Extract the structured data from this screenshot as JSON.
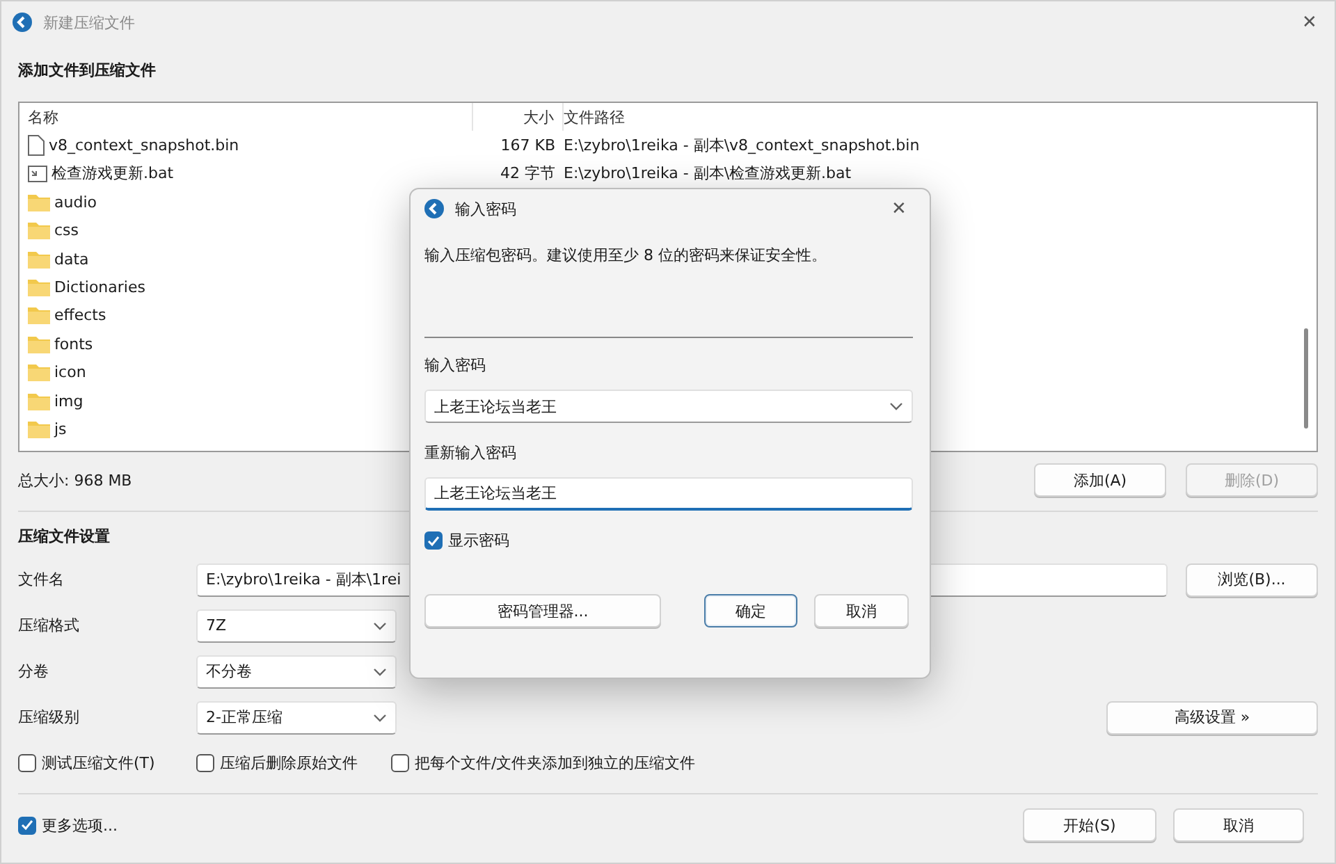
{
  "window": {
    "title": "新建压缩文件",
    "close": "✕"
  },
  "add_section": {
    "title": "添加文件到压缩文件"
  },
  "file_list": {
    "columns": [
      "名称",
      "大小",
      "文件路径"
    ],
    "rows": [
      {
        "kind": "file",
        "name": "v8_context_snapshot.bin",
        "size": "167 KB",
        "path": "E:\\zybro\\1reika - 副本\\v8_context_snapshot.bin"
      },
      {
        "kind": "script",
        "name": "检查游戏更新.bat",
        "size": "42 字节",
        "path": "E:\\zybro\\1reika - 副本\\检查游戏更新.bat"
      },
      {
        "kind": "folder",
        "name": "audio"
      },
      {
        "kind": "folder",
        "name": "css"
      },
      {
        "kind": "folder",
        "name": "data"
      },
      {
        "kind": "folder",
        "name": "Dictionaries"
      },
      {
        "kind": "folder",
        "name": "effects"
      },
      {
        "kind": "folder",
        "name": "fonts"
      },
      {
        "kind": "folder",
        "name": "icon"
      },
      {
        "kind": "folder",
        "name": "img"
      },
      {
        "kind": "folder",
        "name": "js"
      }
    ]
  },
  "total": "总大小: 968 MB",
  "list_buttons": [
    {
      "label": "添加(A)",
      "disabled": false
    },
    {
      "label": "删除(D)",
      "disabled": true
    }
  ],
  "settings": {
    "title": "压缩文件设置",
    "filename": {
      "label": "文件名",
      "value": "E:\\zybro\\1reika - 副本\\1rei",
      "browse": "浏览(B)..."
    },
    "selects": [
      {
        "label": "压缩格式",
        "value": "7Z"
      },
      {
        "label": "分卷",
        "value": "不分卷"
      },
      {
        "label": "压缩级别",
        "value": "2-正常压缩"
      }
    ],
    "advanced": "高级设置 »",
    "options": [
      {
        "label": "测试压缩文件(T)",
        "checked": false
      },
      {
        "label": "压缩后删除原始文件",
        "checked": false
      },
      {
        "label": "把每个文件/文件夹添加到独立的压缩文件",
        "checked": false
      }
    ]
  },
  "more_options": {
    "label": "更多选项...",
    "checked": true
  },
  "footer_buttons": [
    {
      "label": "开始(S)"
    },
    {
      "label": "取消"
    }
  ],
  "password_dialog": {
    "title": "输入密码",
    "close": "✕",
    "description": "输入压缩包密码。建议使用至少 8 位的密码来保证安全性。",
    "password_label": "输入密码",
    "password_value": "上老王论坛当老王",
    "confirm_label": "重新输入密码",
    "confirm_value": "上老王论坛当老王",
    "show_password": {
      "label": "显示密码",
      "checked": true
    },
    "buttons": [
      {
        "label": "密码管理器...",
        "default": false
      },
      {
        "label": "确定",
        "default": true
      },
      {
        "label": "取消",
        "default": false
      }
    ]
  }
}
